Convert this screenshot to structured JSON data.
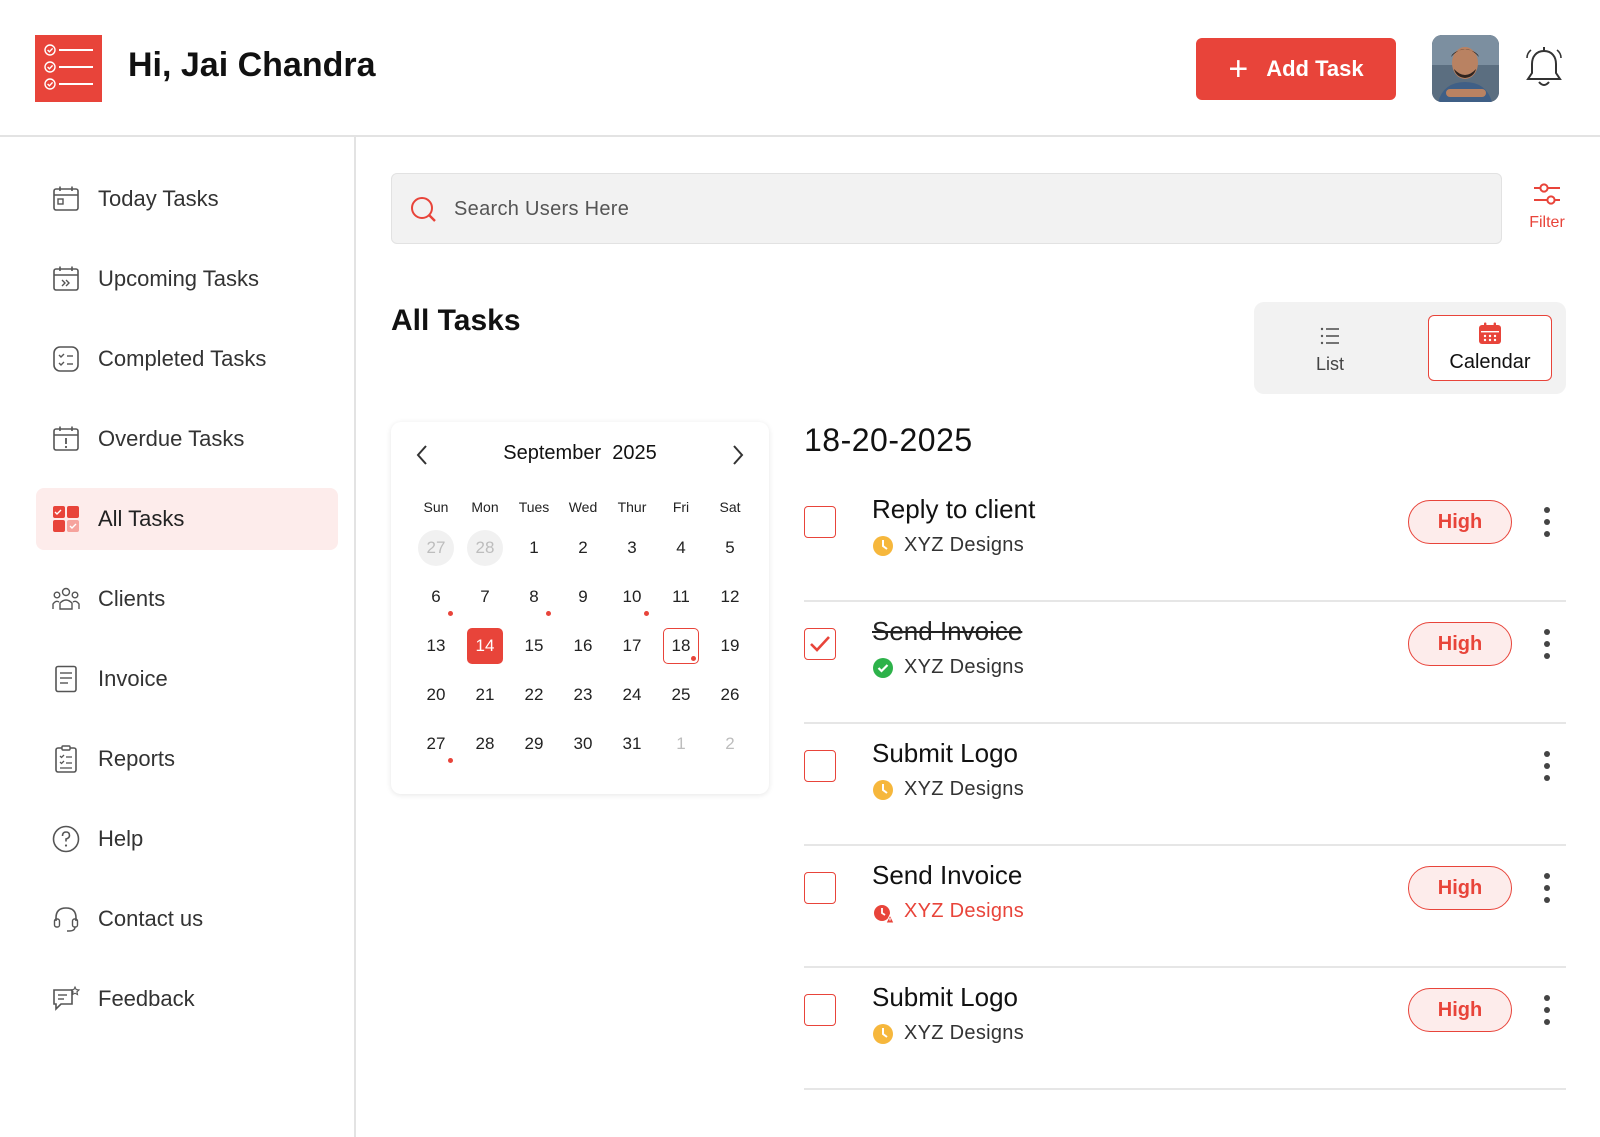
{
  "header": {
    "greeting": "Hi, Jai Chandra",
    "add_task_label": "Add Task",
    "accent_color": "#e8443a"
  },
  "sidebar": {
    "items": [
      {
        "label": "Today Tasks",
        "icon": "calendar-icon"
      },
      {
        "label": "Upcoming Tasks",
        "icon": "calendar-forward-icon"
      },
      {
        "label": "Completed Tasks",
        "icon": "checklist-icon"
      },
      {
        "label": "Overdue Tasks",
        "icon": "calendar-alert-icon"
      },
      {
        "label": "All Tasks",
        "icon": "all-tasks-icon",
        "active": true
      },
      {
        "label": "Clients",
        "icon": "users-icon"
      },
      {
        "label": "Invoice",
        "icon": "invoice-icon"
      },
      {
        "label": "Reports",
        "icon": "report-icon"
      },
      {
        "label": "Help",
        "icon": "help-icon"
      },
      {
        "label": "Contact us",
        "icon": "headset-icon"
      },
      {
        "label": "Feedback",
        "icon": "feedback-icon"
      }
    ]
  },
  "search": {
    "placeholder": "Search Users Here"
  },
  "filter": {
    "label": "Filter"
  },
  "main": {
    "title": "All Tasks",
    "view_toggle": {
      "list_label": "List",
      "calendar_label": "Calendar",
      "selected": "Calendar"
    }
  },
  "calendar": {
    "month": "September",
    "year": "2025",
    "weekdays": [
      "Sun",
      "Mon",
      "Tues",
      "Wed",
      "Thur",
      "Fri",
      "Sat"
    ],
    "weeks": [
      [
        "27",
        "28",
        "1",
        "2",
        "3",
        "4",
        "5"
      ],
      [
        "6",
        "7",
        "8",
        "9",
        "10",
        "11",
        "12"
      ],
      [
        "13",
        "14",
        "15",
        "16",
        "17",
        "18",
        "19"
      ],
      [
        "20",
        "21",
        "22",
        "23",
        "24",
        "25",
        "26"
      ],
      [
        "27",
        "28",
        "29",
        "30",
        "31",
        "1",
        "2"
      ]
    ],
    "today": "14",
    "selected": "18",
    "days_with_tasks": [
      "6",
      "8",
      "10",
      "18",
      "27"
    ]
  },
  "task_list": {
    "date": "18-20-2025",
    "tasks": [
      {
        "name": "Reply to client",
        "client": "XYZ Designs",
        "status": "pending",
        "checked": false,
        "priority": "High"
      },
      {
        "name": "Send Invoice",
        "client": "XYZ Designs",
        "status": "completed",
        "checked": true,
        "priority": "High"
      },
      {
        "name": "Submit Logo",
        "client": "XYZ Designs",
        "status": "pending",
        "checked": false,
        "priority": ""
      },
      {
        "name": "Send Invoice",
        "client": "XYZ Designs",
        "status": "overdue",
        "checked": false,
        "priority": "High"
      },
      {
        "name": "Submit Logo",
        "client": "XYZ Designs",
        "status": "pending",
        "checked": false,
        "priority": "High"
      }
    ]
  }
}
